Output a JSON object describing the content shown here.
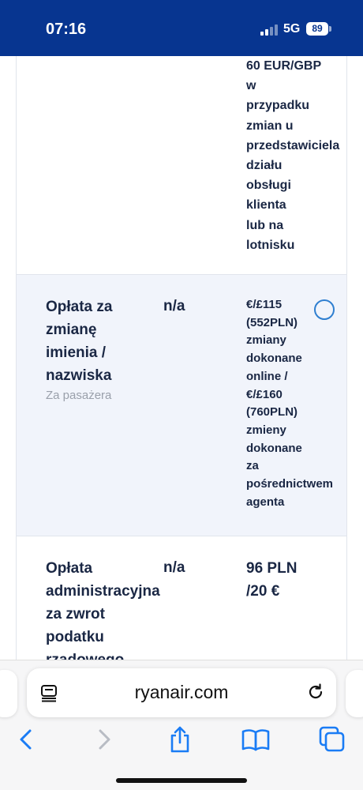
{
  "status_bar": {
    "time": "07:16",
    "network": "5G",
    "battery": "89"
  },
  "fees": [
    {
      "name_lines": [],
      "note": "",
      "online": "",
      "price_lines": [
        "60 EUR/GBP",
        "w",
        "przypadku",
        "zmian u",
        "przedstawiciela",
        "działu",
        "obsługi",
        "klienta",
        "lub na",
        "lotnisku"
      ]
    },
    {
      "name_lines": [
        "Opłata za",
        "zmianę",
        "imienia /",
        "nazwiska"
      ],
      "note": "Za pasażera",
      "online": "n/a",
      "price_lines": [
        "€/£115",
        "(552PLN)",
        "zmiany",
        "dokonane",
        "online /",
        "€/£160",
        "(760PLN)",
        "zmieny",
        "dokonane",
        "za",
        "pośrednictwem",
        "agenta"
      ]
    },
    {
      "name_lines": [
        "Opłata",
        "administracyjna",
        "za zwrot",
        "podatku",
        "rządowego"
      ],
      "note": "",
      "online": "n/a",
      "price_lines": [
        "96 PLN",
        "/20 €"
      ]
    }
  ],
  "browser": {
    "url": "ryanair.com"
  },
  "colors": {
    "brand_blue": "#073590",
    "radio_blue": "#2f7fd0",
    "ios_blue": "#1a7cf5",
    "row_highlight": "#f1f4fb"
  },
  "icons": {
    "reader": "reader-mode-icon",
    "reload": "reload-icon",
    "back": "back-icon",
    "forward": "forward-icon",
    "share": "share-icon",
    "bookmarks": "bookmarks-icon",
    "tabs": "tabs-icon"
  }
}
